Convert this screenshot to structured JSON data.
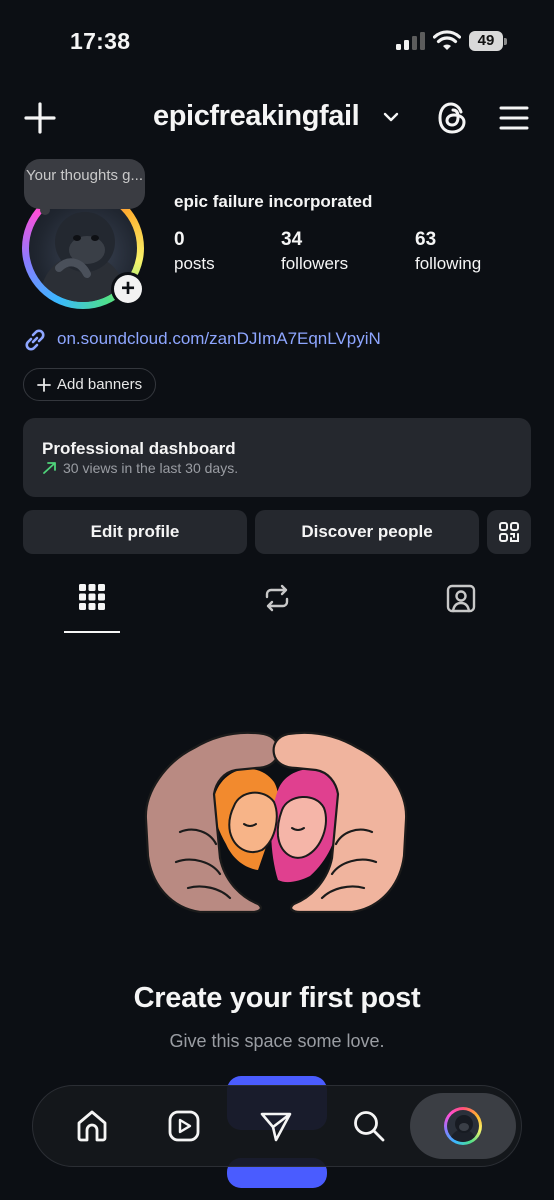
{
  "status_bar": {
    "time": "17:38",
    "battery": "49"
  },
  "header": {
    "username": "epicfreakingfail"
  },
  "note": {
    "text": "Your thoughts g..."
  },
  "profile": {
    "display_name": "epic failure incorporated",
    "stats": [
      {
        "value": "0",
        "label": "posts"
      },
      {
        "value": "34",
        "label": "followers"
      },
      {
        "value": "63",
        "label": "following"
      }
    ],
    "link": "on.soundcloud.com/zanDJImA7EqnLVpyiN",
    "add_banners": "Add banners"
  },
  "dashboard": {
    "title": "Professional dashboard",
    "subtitle": "30 views in the last 30 days."
  },
  "actions": {
    "edit_profile": "Edit profile",
    "discover_people": "Discover people"
  },
  "empty_state": {
    "title": "Create your first post",
    "subtitle": "Give this space some love."
  },
  "colors": {
    "background": "#0c0f14",
    "card": "#25282e",
    "link": "#8ea6ff",
    "accent_button": "#4a5cff",
    "trend_arrow": "#4fd37a"
  },
  "icons": {
    "header": [
      "plus-icon",
      "chevron-down-icon",
      "threads-icon",
      "hamburger-menu-icon"
    ],
    "tabs": [
      "grid-icon",
      "reposts-icon",
      "tagged-icon"
    ],
    "nav": [
      "home-icon",
      "reels-icon",
      "send-icon",
      "search-icon",
      "profile-avatar"
    ]
  }
}
